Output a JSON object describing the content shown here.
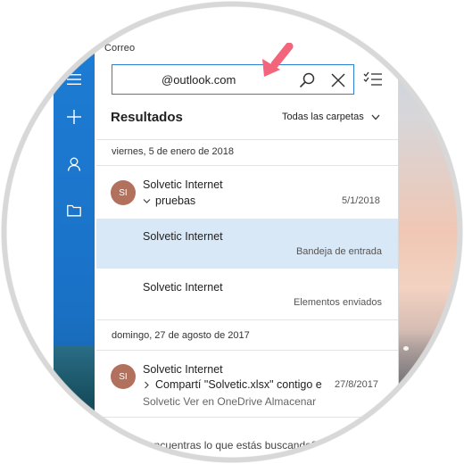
{
  "window": {
    "title": "Correo"
  },
  "search": {
    "value": "@outlook.com"
  },
  "icons": {
    "hamburger": "hamburger-menu-icon",
    "new_mail": "plus-icon",
    "contacts": "person-icon",
    "folders": "folder-icon",
    "search": "search-icon",
    "close": "close-icon",
    "select": "select-mode-icon"
  },
  "results": {
    "title": "Resultados",
    "filter_label": "Todas las carpetas"
  },
  "groups": [
    {
      "header": "viernes, 5 de enero de 2018",
      "thread": {
        "avatar": "SI",
        "sender": "Solvetic Internet",
        "subject": "pruebas",
        "date": "5/1/2018",
        "children": [
          {
            "sender": "Solvetic Internet",
            "folder": "Bandeja de entrada"
          },
          {
            "sender": "Solvetic Internet",
            "folder": "Elementos enviados"
          }
        ]
      }
    },
    {
      "header": "domingo, 27 de agosto de 2017",
      "thread": {
        "avatar": "SI",
        "sender": "Solvetic Internet",
        "subject": "Compartí \"Solvetic.xlsx\" contigo e",
        "date": "27/8/2017",
        "preview": "Solvetic Ver en OneDrive Almacenar"
      }
    }
  ],
  "footer": {
    "text": "¿No encuentras lo que estás buscando? Prueba a"
  },
  "colors": {
    "accent": "#1a72c7",
    "selected": "#d9e8f6",
    "avatar": "#b2715d",
    "arrow": "#f2657a"
  }
}
